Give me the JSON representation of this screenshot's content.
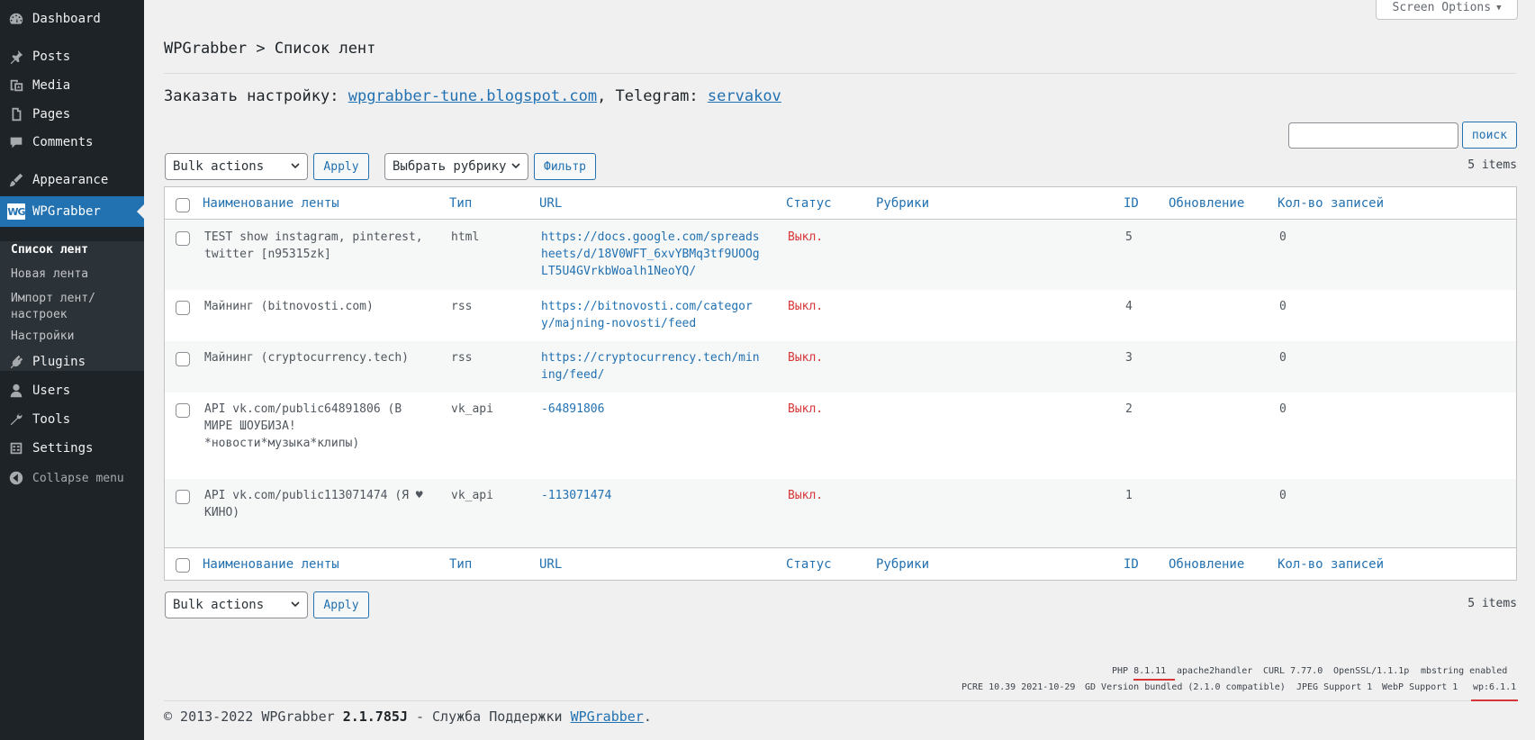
{
  "sidebar": {
    "items": [
      {
        "label": "Dashboard",
        "icon": "dashboard-icon"
      },
      {
        "label": "Posts",
        "icon": "pin-icon"
      },
      {
        "label": "Media",
        "icon": "media-icon"
      },
      {
        "label": "Pages",
        "icon": "pages-icon"
      },
      {
        "label": "Comments",
        "icon": "comment-icon"
      },
      {
        "label": "Appearance",
        "icon": "brush-icon"
      },
      {
        "label": "WPGrabber",
        "icon": "wpgrabber-logo",
        "logo_text": "WG"
      },
      {
        "label": "Plugins",
        "icon": "plugin-icon"
      },
      {
        "label": "Users",
        "icon": "user-icon"
      },
      {
        "label": "Tools",
        "icon": "wrench-icon"
      },
      {
        "label": "Settings",
        "icon": "settings-icon"
      }
    ],
    "submenu": [
      {
        "label": "Список лент"
      },
      {
        "label": "Новая лента"
      },
      {
        "label": "Импорт лент/ настроек"
      },
      {
        "label": "Настройки"
      }
    ],
    "collapse_label": "Collapse menu"
  },
  "screen_options": {
    "label": "Screen Options",
    "arrow": "▼"
  },
  "header": {
    "title": "WPGrabber > Список лент",
    "order_prefix": "Заказать настройку:",
    "order_link": "wpgrabber-tune.blogspot.com",
    "telegram_prefix": ", Telegram:",
    "telegram_link": "servakov"
  },
  "search": {
    "button_label": "поиск",
    "value": ""
  },
  "toolbar": {
    "bulk_actions": "Bulk actions",
    "apply": "Apply",
    "category_select": "Выбрать рубрику",
    "filter": "Фильтр",
    "items_count": "5 items"
  },
  "table": {
    "columns": [
      "Наименование ленты",
      "Тип",
      "URL",
      "Статус",
      "Рубрики",
      "ID",
      "Обновление",
      "Кол-во записей"
    ],
    "rows": [
      {
        "name": "TEST show instagram, pinterest, twitter [n95315zk]",
        "type": "html",
        "url": "https://docs.google.com/spreadsheets/d/18V0WFT_6xvYBMq3tf9UOOgLT5U4GVrkbWoalh1NeoYQ/",
        "status": "Выкл.",
        "categories": "",
        "id": "5",
        "updated": "",
        "count": "0"
      },
      {
        "name": "Майнинг (bitnovosti.com)",
        "type": "rss",
        "url": "https://bitnovosti.com/category/majning-novosti/feed",
        "status": "Выкл.",
        "categories": "",
        "id": "4",
        "updated": "",
        "count": "0"
      },
      {
        "name": "Майнинг (cryptocurrency.tech)",
        "type": "rss",
        "url": "https://cryptocurrency.tech/mining/feed/",
        "status": "Выкл.",
        "categories": "",
        "id": "3",
        "updated": "",
        "count": "0"
      },
      {
        "name": "API vk.com/public64891806 (В МИРЕ ШОУБИЗА! *новости*музыка*клипы)",
        "type": "vk_api",
        "url": "-64891806",
        "status": "Выкл.",
        "categories": "",
        "id": "2",
        "updated": "",
        "count": "0"
      },
      {
        "name": "API vk.com/public113071474 (Я ♥ КИНО)",
        "type": "vk_api",
        "url": "-113071474",
        "status": "Выкл.",
        "categories": "",
        "id": "1",
        "updated": "",
        "count": "0"
      }
    ]
  },
  "system_info": {
    "line1": [
      "PHP 8.1.11",
      "apache2handler",
      "CURL 7.77.0",
      "OpenSSL/1.1.1p",
      "mbstring enabled"
    ],
    "line2": [
      "PCRE 10.39 2021-10-29",
      "GD Version bundled (2.1.0 compatible)",
      "JPEG Support 1",
      "WebP Support 1",
      "wp:6.1.1"
    ]
  },
  "footer": {
    "copyright": "© 2013-2022 WPGrabber",
    "version": "2.1.785J",
    "support_text": "- Служба Поддержки",
    "support_link": "WPGrabber",
    "period": "."
  },
  "colors": {
    "accent": "#2271b1",
    "sidebar": "#1d2327",
    "status_off": "#d63638"
  }
}
